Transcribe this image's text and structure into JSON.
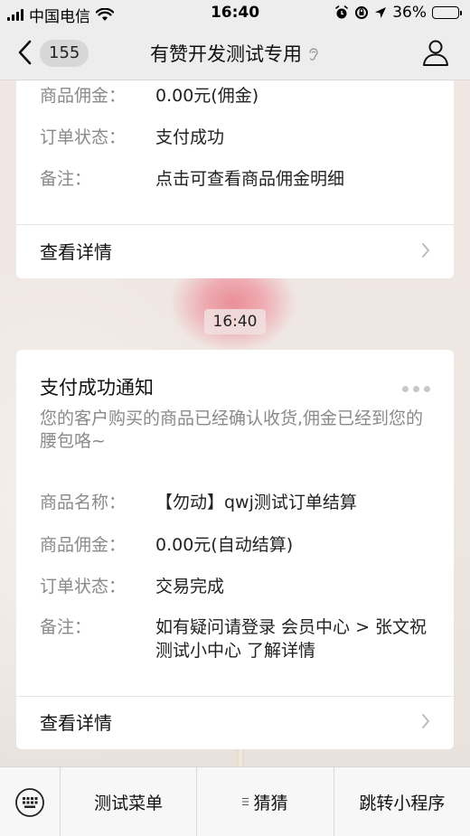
{
  "status_bar": {
    "carrier": "中国电信",
    "time": "16:40",
    "battery_percent": "36%",
    "battery_level": 0.36
  },
  "nav": {
    "unread_count": "155",
    "title": "有赞开发测试专用"
  },
  "messages": [
    {
      "rows": [
        {
          "label": "商品佣金：",
          "value": "0.00元(佣金)"
        },
        {
          "label": "订单状态：",
          "value": "支付成功"
        },
        {
          "label": "备注：",
          "value": "点击可查看商品佣金明细"
        }
      ],
      "detail_label": "查看详情"
    },
    {
      "title": "支付成功通知",
      "description": "您的客户购买的商品已经确认收货,佣金已经到您的腰包咯~",
      "rows": [
        {
          "label": "商品名称：",
          "value": "【勿动】qwj测试订单结算"
        },
        {
          "label": "商品佣金：",
          "value": "0.00元(自动结算)"
        },
        {
          "label": "订单状态：",
          "value": "交易完成"
        },
        {
          "label": "备注：",
          "value": "如有疑问请登录 会员中心 > 张文祝测试小中心 了解详情"
        }
      ],
      "detail_label": "查看详情"
    }
  ],
  "timestamp": "16:40",
  "menu": {
    "items": [
      {
        "label": "测试菜单"
      },
      {
        "label": "猜猜"
      },
      {
        "label": "跳转小程序"
      }
    ]
  }
}
